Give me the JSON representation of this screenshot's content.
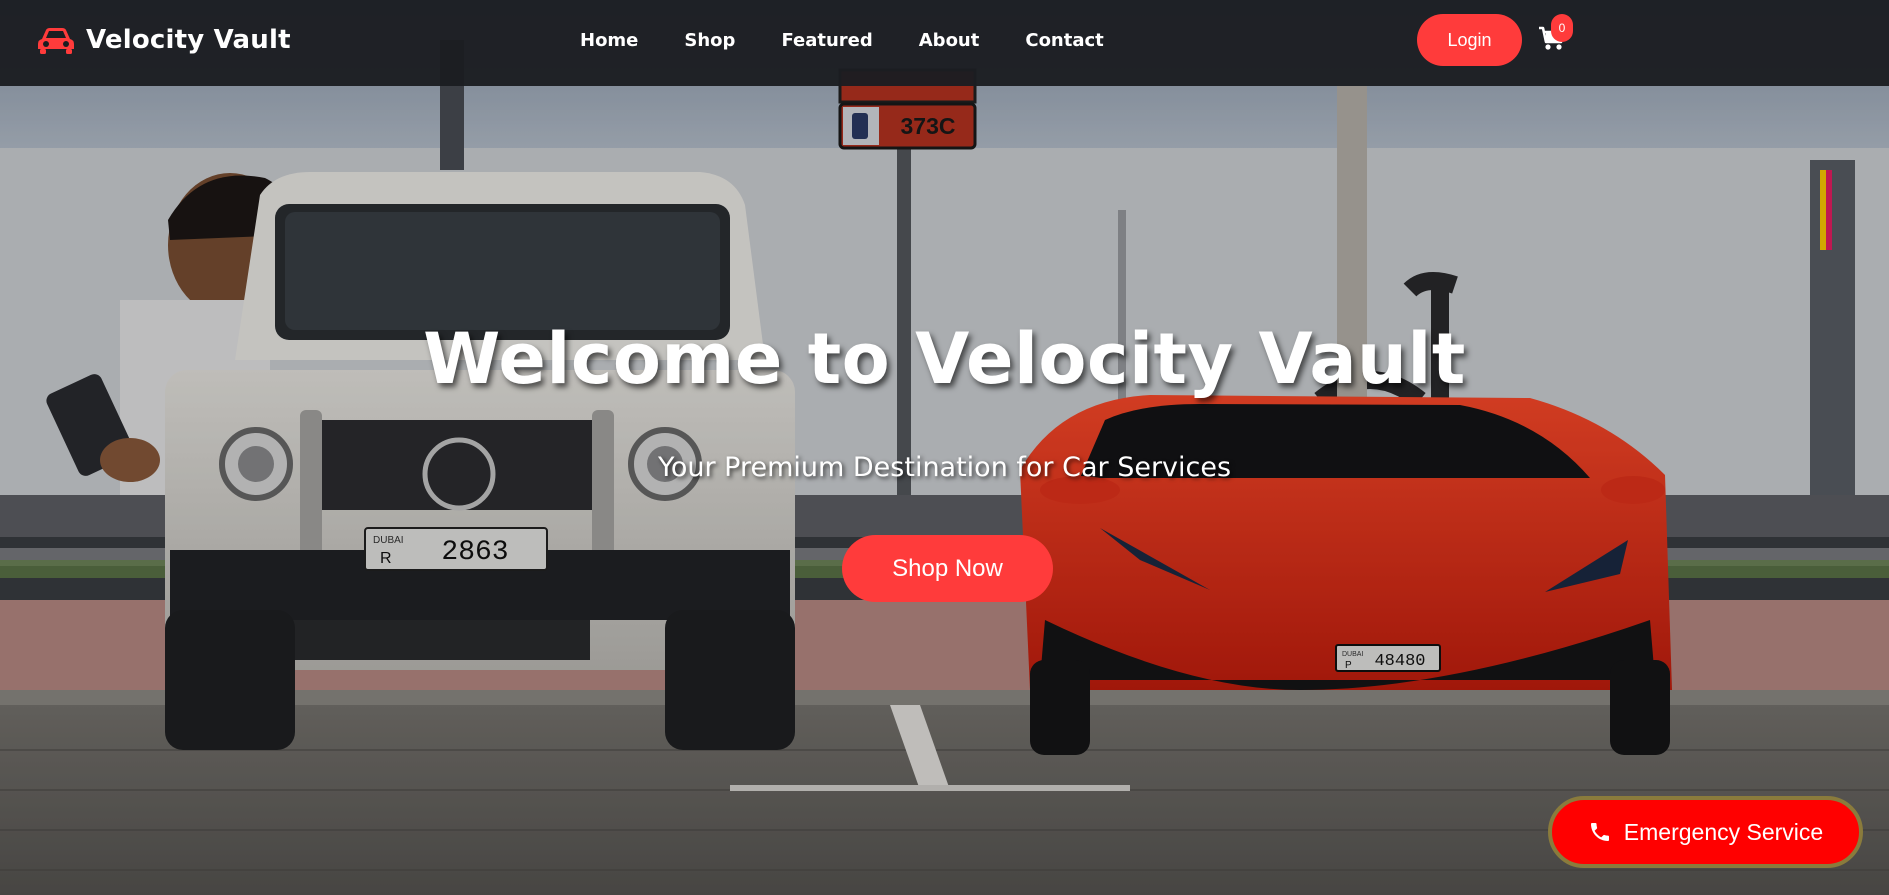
{
  "brand": {
    "name": "Velocity Vault",
    "icon": "car-icon",
    "accent": "#ff3b3b"
  },
  "nav": {
    "items": [
      {
        "label": "Home"
      },
      {
        "label": "Shop"
      },
      {
        "label": "Featured"
      },
      {
        "label": "About"
      },
      {
        "label": "Contact"
      }
    ],
    "login_label": "Login",
    "cart": {
      "icon": "cart-icon",
      "count": "0"
    }
  },
  "hero": {
    "title": "Welcome to Velocity Vault",
    "subtitle": "Your Premium Destination for Car Services",
    "cta_label": "Shop Now",
    "photo": {
      "sign_text": "373C",
      "plate_left": {
        "emirate": "DUBAI",
        "letter": "R",
        "number": "2863"
      },
      "plate_right": {
        "emirate": "DUBAI",
        "letter": "P",
        "number": "48480"
      }
    }
  },
  "emergency": {
    "label": "Emergency Service",
    "icon": "phone-icon",
    "color": "#ff0000"
  }
}
